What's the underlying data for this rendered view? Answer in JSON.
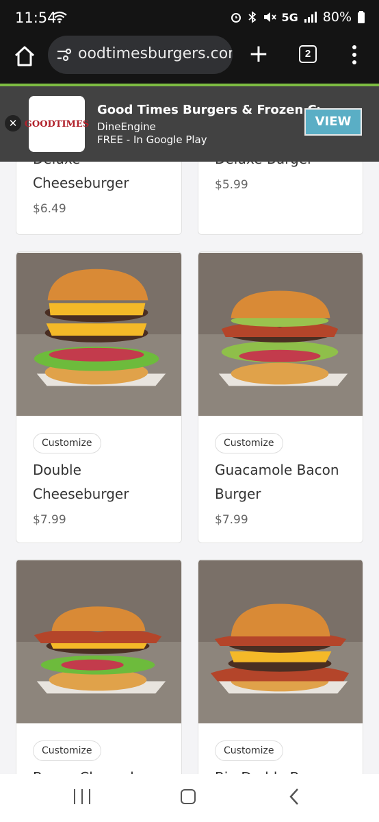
{
  "status": {
    "time": "11:54",
    "network": "5G",
    "battery": "80%"
  },
  "browser": {
    "url": "oodtimesburgers.com",
    "tab_count": "2"
  },
  "banner": {
    "logo_text": "GOODTIMES",
    "title": "Good Times Burgers & Frozen Custard",
    "developer": "DineEngine",
    "price_line": "FREE - In Google Play",
    "view_label": "VIEW"
  },
  "menu": {
    "customize_label": "Customize",
    "items": [
      {
        "name": "Deluxe Cheeseburger",
        "name_line1": "Deluxe",
        "name_line2": "Cheeseburger",
        "price": "$6.49"
      },
      {
        "name": "Deluxe Burger",
        "name_line1": "Deluxe Burger",
        "price": "$5.99"
      },
      {
        "name": "Double Cheeseburger",
        "name_line1": "Double",
        "name_line2": "Cheeseburger",
        "price": "$7.99"
      },
      {
        "name": "Guacamole Bacon Burger",
        "name_line1": "Guacamole Bacon",
        "name_line2": "Burger",
        "price": "$7.99"
      },
      {
        "name": "Bacon Cheeseburger",
        "name_line1": "Bacon Cheeseb",
        "price": ""
      },
      {
        "name": "Big Daddy Bacon",
        "name_line1": "Big Daddy Ba",
        "price": ""
      }
    ]
  },
  "colors": {
    "accent_green": "#7dbd42",
    "view_button": "#5aaec5",
    "brand_red": "#b0202a"
  }
}
